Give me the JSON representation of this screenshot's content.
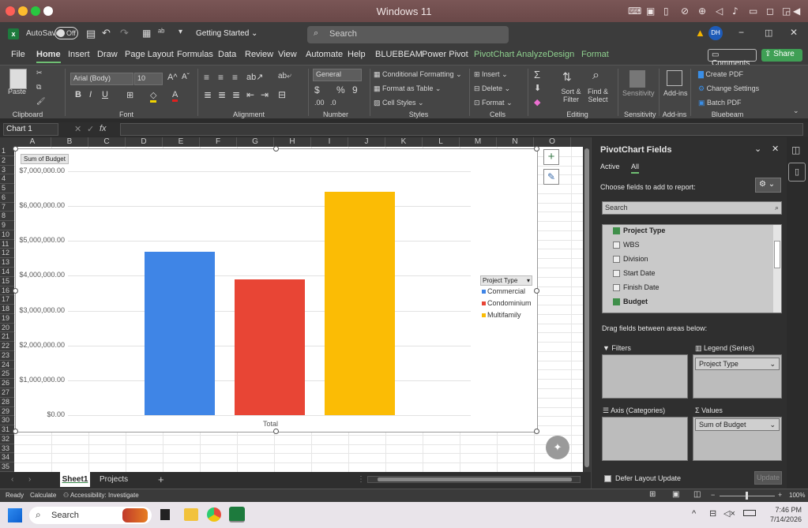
{
  "mac": {
    "title": "Windows 11",
    "dots": [
      "#ff5f57",
      "#febc2e",
      "#28c840",
      "#ffffff"
    ]
  },
  "excel": {
    "autosave_label": "AutoSave",
    "autosave_state": "Off",
    "doc_title": "Getting Started",
    "search_placeholder": "Search",
    "user_initials": "DH"
  },
  "tabs": [
    "File",
    "Home",
    "Insert",
    "Draw",
    "Page Layout",
    "Formulas",
    "Data",
    "Review",
    "View",
    "Automate",
    "Help",
    "BLUEBEAM",
    "Power Pivot",
    "PivotChart Analyze",
    "Design",
    "Format"
  ],
  "tab_active": "Home",
  "comments_label": "Comments",
  "share_label": "Share",
  "ribbon": {
    "paste": "Paste",
    "font_name": "Arial (Body)",
    "font_size": "10",
    "number_format": "General",
    "conditional_formatting": "Conditional Formatting",
    "format_as_table": "Format as Table",
    "cell_styles": "Cell Styles",
    "insert": "Insert",
    "delete": "Delete",
    "format": "Format",
    "sort_filter": "Sort & Filter",
    "find_select": "Find & Select",
    "sensitivity": "Sensitivity",
    "add_ins": "Add-ins",
    "create_pdf": "Create PDF",
    "change_settings": "Change Settings",
    "batch_pdf": "Batch PDF",
    "groups": {
      "clipboard": "Clipboard",
      "font": "Font",
      "alignment": "Alignment",
      "number": "Number",
      "styles": "Styles",
      "cells": "Cells",
      "editing": "Editing",
      "sensitivity": "Sensitivity",
      "add_ins": "Add-ins",
      "bluebeam": "Bluebeam"
    }
  },
  "formula_bar": {
    "name_box": "Chart 1",
    "fx": "fx"
  },
  "columns": [
    "A",
    "B",
    "C",
    "D",
    "E",
    "F",
    "G",
    "H",
    "I",
    "J",
    "K",
    "L",
    "M",
    "N",
    "O"
  ],
  "rows": [
    "1",
    "2",
    "3",
    "4",
    "5",
    "6",
    "7",
    "8",
    "9",
    "10",
    "11",
    "12",
    "13",
    "14",
    "15",
    "16",
    "17",
    "18",
    "19",
    "20",
    "21",
    "22",
    "23",
    "24",
    "25",
    "26",
    "27",
    "28",
    "29",
    "30",
    "31",
    "32",
    "33",
    "34",
    "35"
  ],
  "chart_data": {
    "type": "bar",
    "field_button": "Sum of Budget",
    "categories": [
      "Total"
    ],
    "series": [
      {
        "name": "Commercial",
        "values": [
          4700000
        ],
        "color": "#3f85e6"
      },
      {
        "name": "Condominium",
        "values": [
          3900000
        ],
        "color": "#e84535"
      },
      {
        "name": "Multifamily",
        "values": [
          6400000
        ],
        "color": "#fbbc05"
      }
    ],
    "yticks": [
      "$7,000,000.00",
      "$6,000,000.00",
      "$5,000,000.00",
      "$4,000,000.00",
      "$3,000,000.00",
      "$2,000,000.00",
      "$1,000,000.00",
      "$0.00"
    ],
    "ylim": [
      0,
      7000000
    ],
    "legend_title": "Project Type",
    "legend_position": "right",
    "grid": true
  },
  "pane": {
    "title": "PivotChart Fields",
    "tab_active": "Active",
    "tab_all": "All",
    "choose_label": "Choose fields to add to report:",
    "search_placeholder": "Search",
    "fields": [
      {
        "name": "Project Type",
        "checked": true,
        "bold": true
      },
      {
        "name": "WBS",
        "checked": false
      },
      {
        "name": "Division",
        "checked": false
      },
      {
        "name": "Start Date",
        "checked": false
      },
      {
        "name": "Finish Date",
        "checked": false
      },
      {
        "name": "Budget",
        "checked": true,
        "bold": true
      }
    ],
    "drag_label": "Drag fields between areas below:",
    "filters_label": "Filters",
    "legend_label": "Legend (Series)",
    "legend_pill": "Project Type",
    "axis_label": "Axis (Categories)",
    "values_label": "Values",
    "values_pill": "Sum of Budget",
    "defer_label": "Defer Layout Update",
    "update_label": "Update"
  },
  "sheet_tabs": [
    "Sheet1",
    "Projects"
  ],
  "status": {
    "ready": "Ready",
    "calculate": "Calculate",
    "accessibility": "Accessibility: Investigate",
    "zoom": "100%"
  },
  "taskbar": {
    "search_placeholder": "Search",
    "time": "7:46 PM",
    "date": "7/14/2026"
  }
}
